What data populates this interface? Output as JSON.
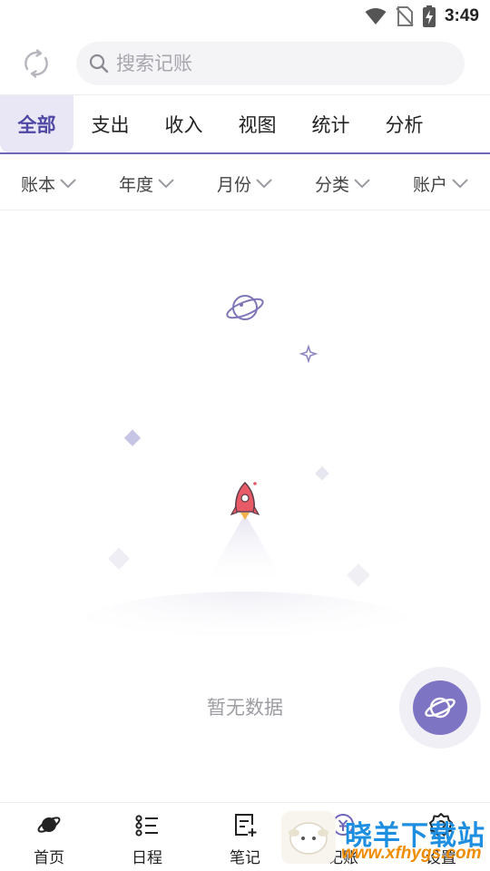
{
  "status_bar": {
    "time": "3:49",
    "icons": [
      "wifi-icon",
      "no-sim-icon",
      "battery-charging-icon"
    ]
  },
  "search": {
    "placeholder": "搜索记账"
  },
  "tabs": [
    {
      "label": "全部",
      "active": true
    },
    {
      "label": "支出"
    },
    {
      "label": "收入"
    },
    {
      "label": "视图"
    },
    {
      "label": "统计"
    },
    {
      "label": "分析"
    }
  ],
  "filters": [
    {
      "label": "账本"
    },
    {
      "label": "年度"
    },
    {
      "label": "月份"
    },
    {
      "label": "分类"
    },
    {
      "label": "账户"
    }
  ],
  "empty_state": {
    "text": "暂无数据"
  },
  "bottom_nav": [
    {
      "label": "首页",
      "icon": "planet-icon"
    },
    {
      "label": "日程",
      "icon": "schedule-list-icon"
    },
    {
      "label": "笔记",
      "icon": "note-add-icon"
    },
    {
      "label": "记账",
      "icon": "bookkeeping-icon"
    },
    {
      "label": "设置",
      "icon": "gear-icon"
    }
  ],
  "watermark": {
    "title": "晓羊下载站",
    "url": "www.xfhygs.com"
  },
  "colors": {
    "accent": "#6e66b8",
    "active_tab_bg": "#e9e7f5",
    "fab": "#7e74c4",
    "rocket": "#e85a66"
  }
}
